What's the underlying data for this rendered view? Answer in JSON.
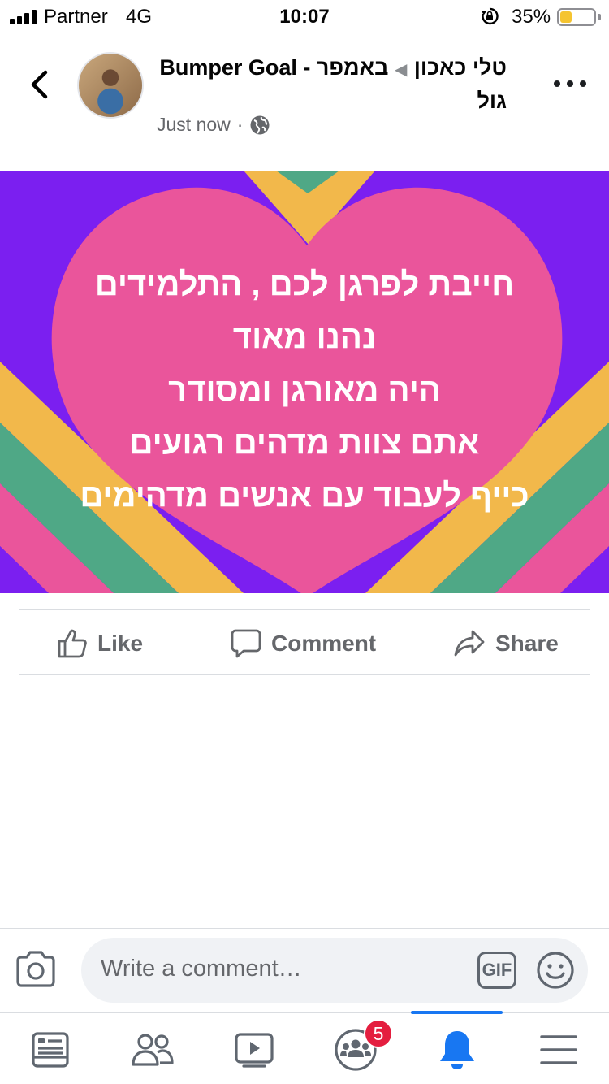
{
  "status_bar": {
    "carrier": "Partner",
    "network": "4G",
    "time": "10:07",
    "battery_percent": "35%",
    "battery_level": 0.35,
    "battery_color": "#f5c430"
  },
  "post": {
    "author": "טלי כאכון",
    "group": "באמפר - Bumper Goal",
    "author_line2": "גול",
    "timestamp": "Just now",
    "privacy_icon": "globe-icon",
    "image_text_lines": [
      "חייבת לפרגן לכם , התלמידים",
      "נהנו מאוד",
      "היה מאורגן ומסודר",
      "אתם צוות מדהים רגועים",
      "כייף לעבוד עם אנשים מדהימים"
    ],
    "image_colors": {
      "background": "#7b1ff0",
      "heart": "#ea559b",
      "yellow_stripe": "#f2b84b",
      "green_stripe": "#4fa886"
    }
  },
  "actions": {
    "like": "Like",
    "comment": "Comment",
    "share": "Share"
  },
  "composer": {
    "placeholder": "Write a comment…",
    "gif_label": "GIF"
  },
  "tabbar": {
    "tabs": [
      "news-feed-icon",
      "friends-icon",
      "watch-icon",
      "groups-icon",
      "notifications-icon",
      "menu-icon"
    ],
    "active_tab": "notifications-icon",
    "groups_badge": "5",
    "accent": "#1877f2"
  }
}
